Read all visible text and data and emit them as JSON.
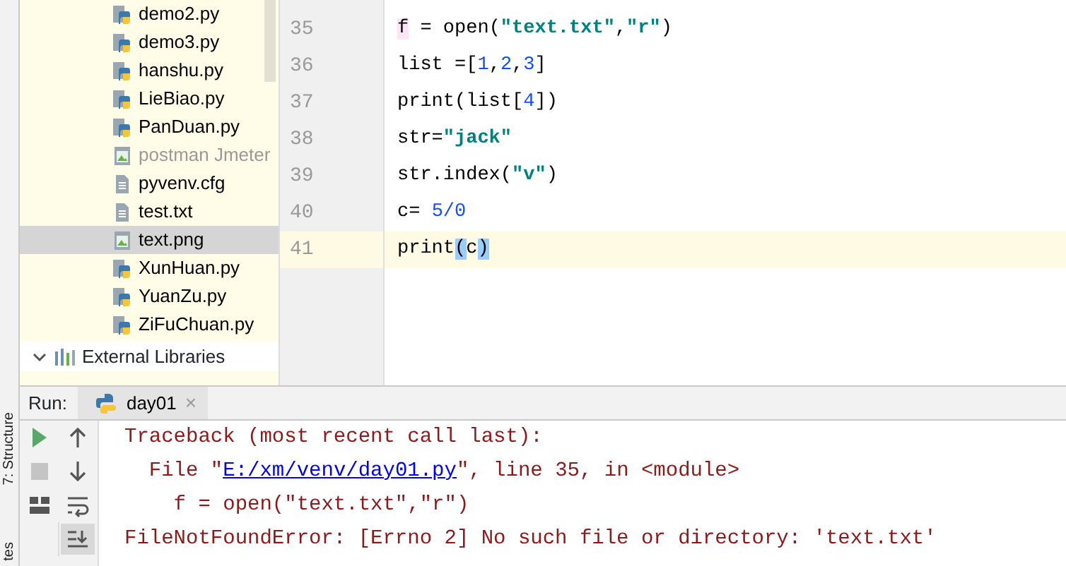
{
  "side_strip": [
    {
      "label": "7: Structure"
    },
    {
      "label": "tes"
    }
  ],
  "project_tree": {
    "items": [
      {
        "label": "demo2.py",
        "kind": "python",
        "dimmed": false,
        "selected": false
      },
      {
        "label": "demo3.py",
        "kind": "python",
        "dimmed": false,
        "selected": false
      },
      {
        "label": "hanshu.py",
        "kind": "python",
        "dimmed": false,
        "selected": false
      },
      {
        "label": "LieBiao.py",
        "kind": "python",
        "dimmed": false,
        "selected": false
      },
      {
        "label": "PanDuan.py",
        "kind": "python",
        "dimmed": false,
        "selected": false
      },
      {
        "label": "postman Jmeter",
        "kind": "image",
        "dimmed": true,
        "selected": false
      },
      {
        "label": "pyvenv.cfg",
        "kind": "text",
        "dimmed": false,
        "selected": false
      },
      {
        "label": "test.txt",
        "kind": "text",
        "dimmed": false,
        "selected": false
      },
      {
        "label": "text.png",
        "kind": "image",
        "dimmed": false,
        "selected": true
      },
      {
        "label": "XunHuan.py",
        "kind": "python",
        "dimmed": false,
        "selected": false
      },
      {
        "label": "YuanZu.py",
        "kind": "python",
        "dimmed": false,
        "selected": false
      },
      {
        "label": "ZiFuChuan.py",
        "kind": "python",
        "dimmed": false,
        "selected": false
      }
    ],
    "external": {
      "label": "External Libraries",
      "expanded": true
    }
  },
  "editor": {
    "lines": [
      {
        "number": "35",
        "current": false,
        "tokens": [
          {
            "text": "f",
            "kind": "mark"
          },
          {
            "text": " = open(",
            "kind": "code"
          },
          {
            "text": "\"text.txt\"",
            "kind": "string"
          },
          {
            "text": ",",
            "kind": "code"
          },
          {
            "text": "\"r\"",
            "kind": "string"
          },
          {
            "text": ")",
            "kind": "code"
          }
        ]
      },
      {
        "number": "36",
        "current": false,
        "tokens": [
          {
            "text": "list =[",
            "kind": "code"
          },
          {
            "text": "1",
            "kind": "number"
          },
          {
            "text": ",",
            "kind": "code"
          },
          {
            "text": "2",
            "kind": "number"
          },
          {
            "text": ",",
            "kind": "code"
          },
          {
            "text": "3",
            "kind": "number"
          },
          {
            "text": "]",
            "kind": "code"
          }
        ]
      },
      {
        "number": "37",
        "current": false,
        "tokens": [
          {
            "text": "print(list[",
            "kind": "code"
          },
          {
            "text": "4",
            "kind": "number"
          },
          {
            "text": "])",
            "kind": "code"
          }
        ]
      },
      {
        "number": "38",
        "current": false,
        "tokens": [
          {
            "text": "str=",
            "kind": "code"
          },
          {
            "text": "\"jack\"",
            "kind": "string"
          }
        ]
      },
      {
        "number": "39",
        "current": false,
        "tokens": [
          {
            "text": "str.index(",
            "kind": "code"
          },
          {
            "text": "\"v\"",
            "kind": "string"
          },
          {
            "text": ")",
            "kind": "code"
          }
        ]
      },
      {
        "number": "40",
        "current": false,
        "tokens": [
          {
            "text": "c= ",
            "kind": "code"
          },
          {
            "text": "5/0",
            "kind": "number"
          }
        ]
      },
      {
        "number": "41",
        "current": true,
        "tokens": [
          {
            "text": "print",
            "kind": "code"
          },
          {
            "text": "(",
            "kind": "match"
          },
          {
            "text": "c",
            "kind": "code"
          },
          {
            "text": ")",
            "kind": "match"
          }
        ]
      }
    ]
  },
  "run_panel": {
    "label": "Run:",
    "tabs": [
      {
        "label": "day01",
        "selected": true,
        "close": "×"
      }
    ],
    "toolbar": [
      {
        "kind": "run",
        "selected": false
      },
      {
        "kind": "up",
        "selected": false
      },
      {
        "kind": "stop",
        "selected": false
      },
      {
        "kind": "down",
        "selected": false
      },
      {
        "kind": "layout",
        "selected": false
      },
      {
        "kind": "wrap",
        "selected": false
      },
      {
        "kind": "blank"
      },
      {
        "kind": "scroll-end",
        "selected": true
      }
    ],
    "console": [
      {
        "tokens": [
          {
            "text": "Traceback (most recent call last):",
            "kind": "error"
          }
        ]
      },
      {
        "tokens": [
          {
            "text": "  File \"",
            "kind": "error"
          },
          {
            "text": "E:/xm/venv/day01.py",
            "kind": "link"
          },
          {
            "text": "\", line 35, in <module>",
            "kind": "error"
          }
        ]
      },
      {
        "tokens": [
          {
            "text": "    f = open(\"text.txt\",\"r\")",
            "kind": "error"
          }
        ]
      },
      {
        "tokens": [
          {
            "text": "FileNotFoundError: [Errno 2] No such file or directory: 'text.txt'",
            "kind": "error"
          }
        ]
      }
    ]
  }
}
